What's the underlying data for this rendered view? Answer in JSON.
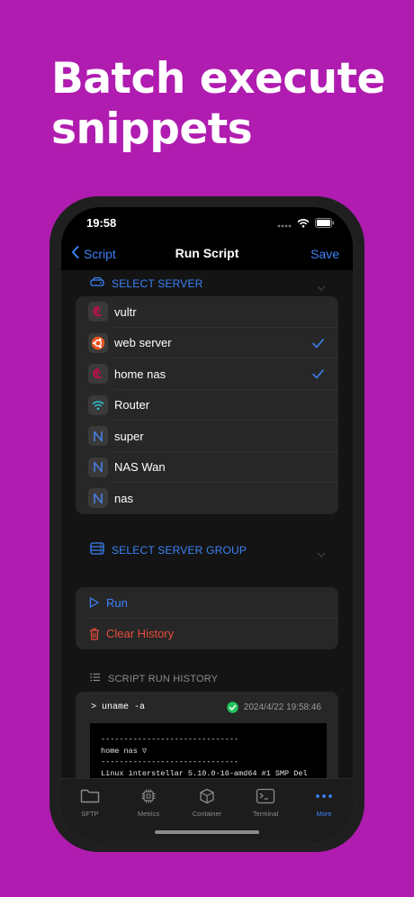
{
  "headline": {
    "line1": "Batch execute",
    "line2": "snippets"
  },
  "status": {
    "time": "19:58"
  },
  "nav": {
    "back_label": "Script",
    "title": "Run Script",
    "save_label": "Save"
  },
  "select_server": {
    "header": "SELECT SERVER",
    "servers": [
      {
        "name": "vultr",
        "icon": "debian-icon",
        "checked": false
      },
      {
        "name": "web server",
        "icon": "ubuntu-icon",
        "checked": true
      },
      {
        "name": "home nas",
        "icon": "debian-icon",
        "checked": true
      },
      {
        "name": "Router",
        "icon": "wifi-icon",
        "checked": false
      },
      {
        "name": "super",
        "icon": "n-icon",
        "checked": false
      },
      {
        "name": "NAS Wan",
        "icon": "n-icon",
        "checked": false
      },
      {
        "name": "nas",
        "icon": "n-icon",
        "checked": false
      }
    ]
  },
  "select_group": {
    "header": "SELECT SERVER GROUP"
  },
  "actions": {
    "run_label": "Run",
    "clear_label": "Clear History"
  },
  "history": {
    "header": "SCRIPT RUN HISTORY",
    "command": "> uname -a",
    "timestamp": "2024/4/22 19:58:46",
    "output": {
      "line1": "------------------------------",
      "line2": "home nas ▽",
      "line3": "------------------------------",
      "line4": "Linux interstellar 5.10.0-16-amd64 #1 SMP Del"
    }
  },
  "tabs": [
    {
      "label": "SFTP",
      "icon": "folder-icon"
    },
    {
      "label": "Metrics",
      "icon": "chip-icon"
    },
    {
      "label": "Container",
      "icon": "box-icon"
    },
    {
      "label": "Terminal",
      "icon": "terminal-icon"
    },
    {
      "label": "More",
      "icon": "more-icon"
    }
  ],
  "colors": {
    "background": "#b01cb0",
    "accent": "#3b82f6",
    "danger": "#e74c3c",
    "success": "#22c55e"
  }
}
